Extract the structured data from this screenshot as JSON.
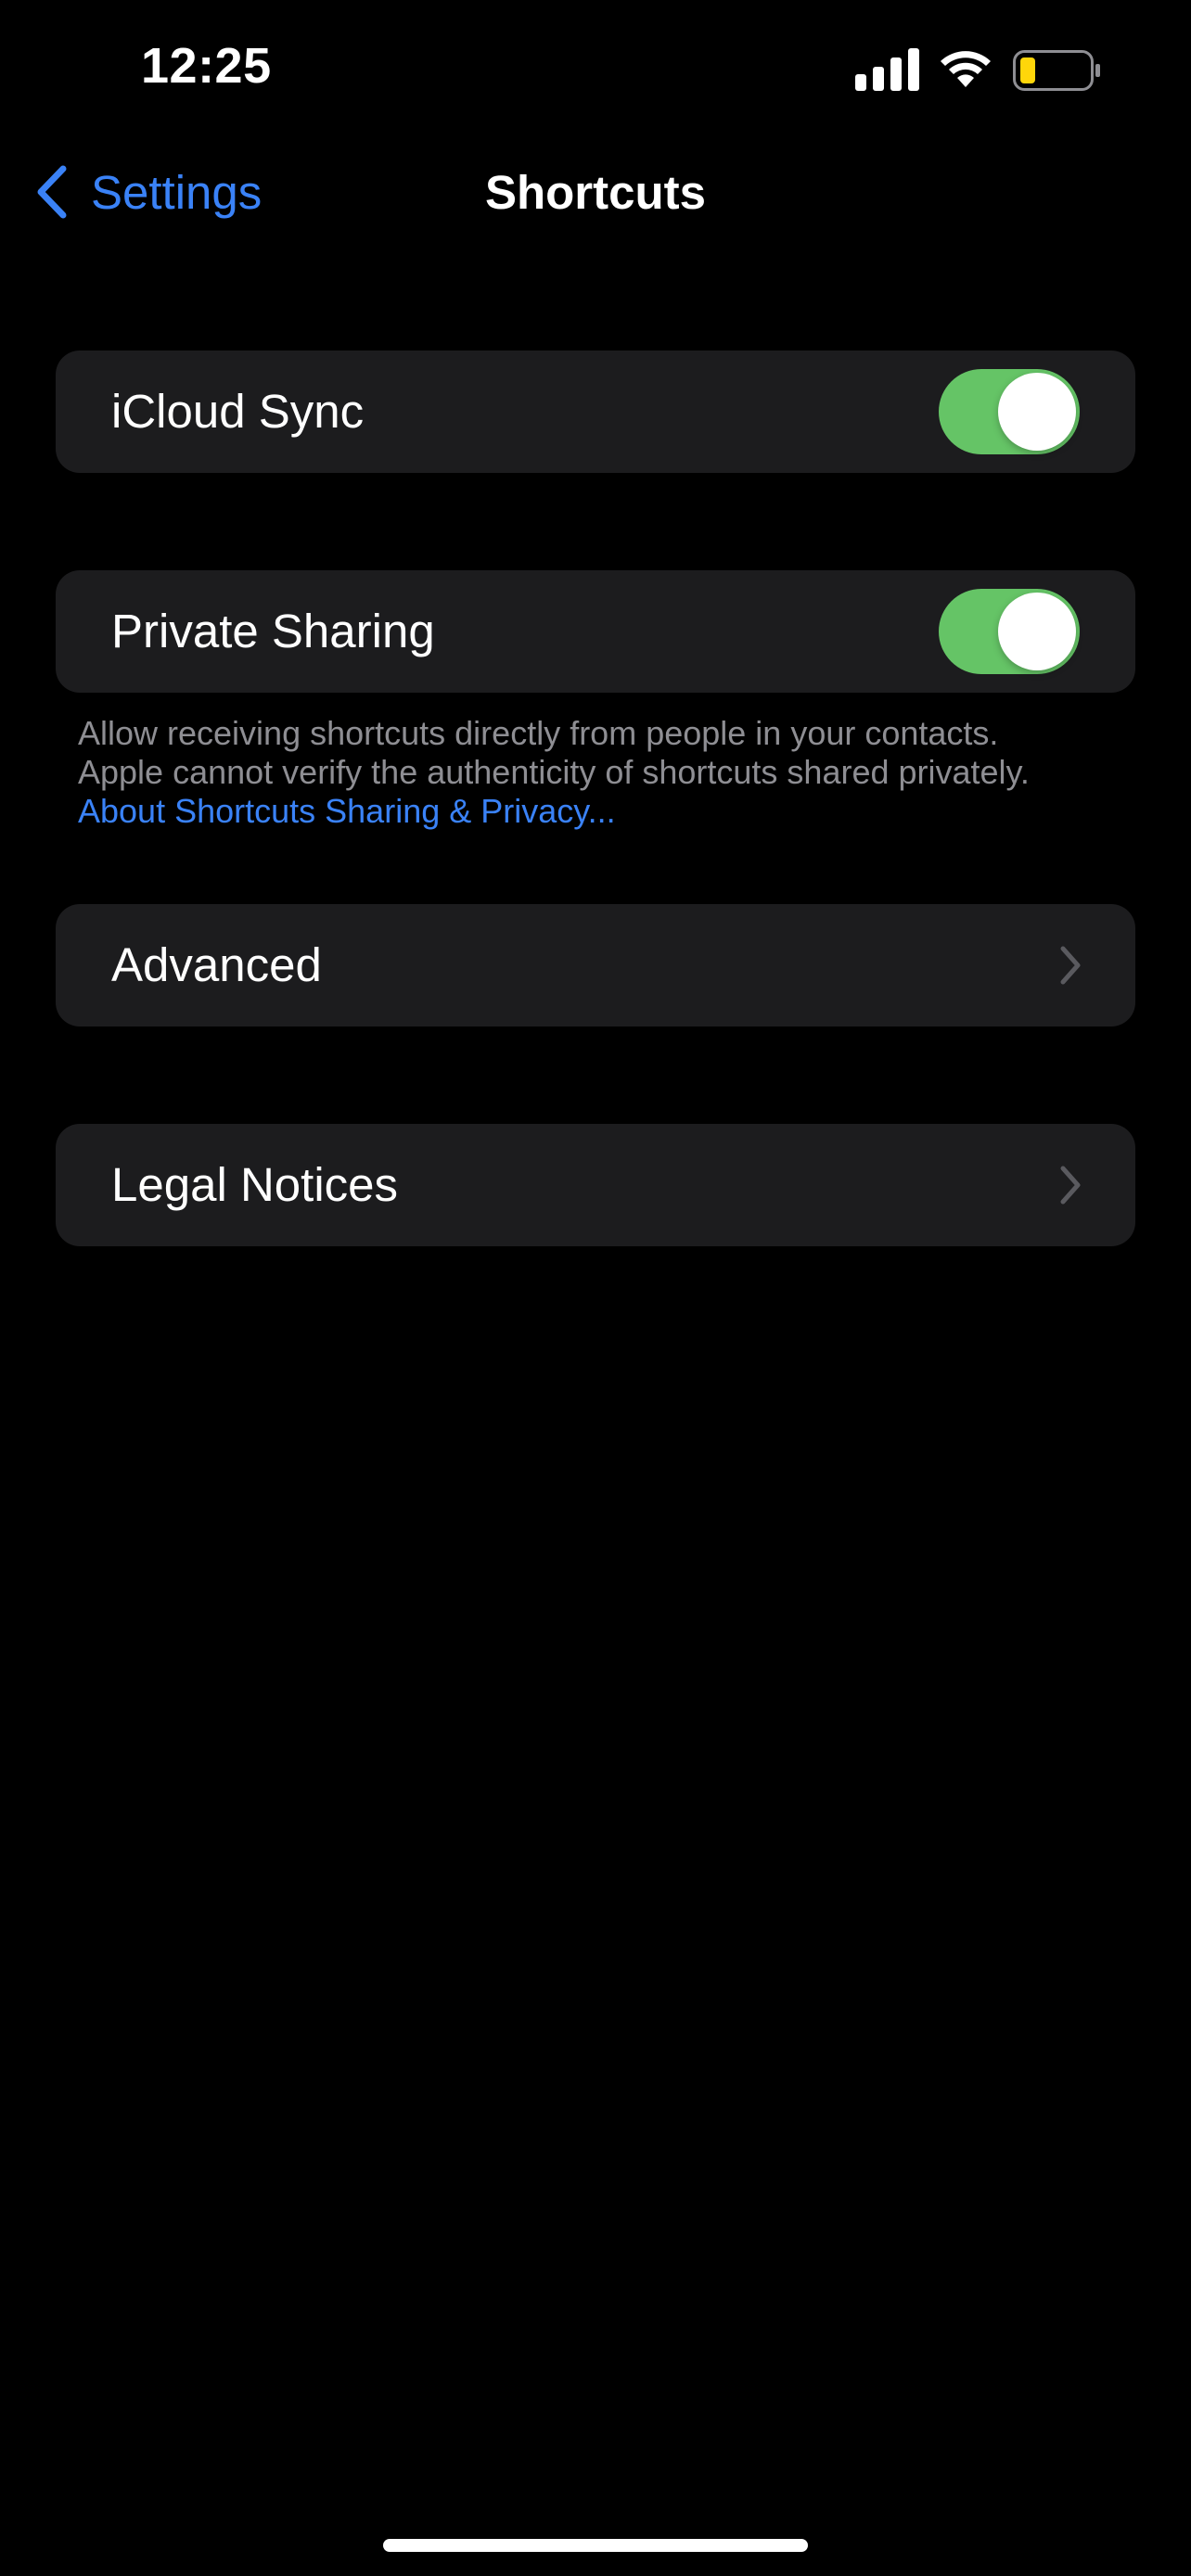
{
  "status_bar": {
    "time": "12:25",
    "signal_icon": "cellular-signal-icon",
    "wifi_icon": "wifi-icon",
    "battery_icon": "battery-low-icon",
    "battery_color": "#ffd60a"
  },
  "nav": {
    "back_label": "Settings",
    "title": "Shortcuts",
    "accent_color": "#3a82f7"
  },
  "settings": {
    "icloud_sync": {
      "label": "iCloud Sync",
      "enabled": true
    },
    "private_sharing": {
      "label": "Private Sharing",
      "enabled": true,
      "footer_line1": "Allow receiving shortcuts directly from people in your contacts.",
      "footer_line2": "Apple cannot verify the authenticity of shortcuts shared privately.",
      "footer_link": "About Shortcuts Sharing & Privacy..."
    },
    "advanced": {
      "label": "Advanced"
    },
    "legal_notices": {
      "label": "Legal Notices"
    }
  },
  "colors": {
    "toggle_on": "#65c466",
    "cell_background": "#1c1c1e",
    "secondary_text": "#8e8e93"
  }
}
